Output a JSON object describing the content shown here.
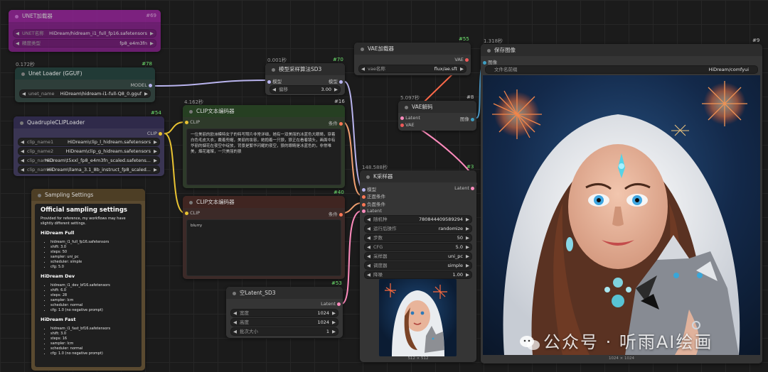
{
  "purple_node": {
    "title": "UNET加载器",
    "id": "#69",
    "field1_label": "UNET名称",
    "field1_value": "HiDream/hidream_i1_full_fp16.safetensors",
    "field2_label": "精度类型",
    "field2_value": "fp8_e4m3fn"
  },
  "unet_loader": {
    "time": "0.172秒",
    "id": "#78",
    "title": "Unet Loader (GGUF)",
    "output": "MODEL",
    "w_label": "unet_name",
    "w_value": "HiDream\\hidream-i1-full-Q8_0.gguf"
  },
  "quad_clip": {
    "id": "#54",
    "title": "QuadrupleCLIPLoader",
    "output": "CLIP",
    "widgets": [
      {
        "label": "clip_name1",
        "value": "HiDream\\clip_l_hidream.safetensors"
      },
      {
        "label": "clip_name2",
        "value": "HiDream\\clip_g_hidream.safetensors"
      },
      {
        "label": "clip_name3",
        "value": "HiDream\\t5xxl_fp8_e4m3fn_scaled.safetens..."
      },
      {
        "label": "clip_name4",
        "value": "HiDream\\llama_3.1_8b_instruct_fp8_scaled..."
      }
    ]
  },
  "model_sampling": {
    "time": "0.001秒",
    "id": "#70",
    "title": "模型采样算法SD3",
    "input": "模型",
    "output": "模型",
    "w_label": "偏移",
    "w_value": "3.00"
  },
  "clip_pos": {
    "time": "4.162秒",
    "id": "#16",
    "title": "CLIP文本编码器",
    "input": "CLIP",
    "output": "条件",
    "text": "一位美丽的欧洲模特女子的特写照片非常详细，她有一双美丽的冰蓝色大眼睛，穿着白色毛皮大衣，戴着兜帽，美丽的妆容，她抱着一只狼，狼正在看着镜头，画面中有华丽的烟花在夜空中绽放，背景是繁华闪耀的夜空，狼的眼睛是冰蓝色的，非常唯美，烟花璀璨，一只美丽的狼"
  },
  "clip_neg": {
    "id": "#40",
    "title": "CLIP文本编码器",
    "input": "CLIP",
    "output": "条件",
    "text": "blurry"
  },
  "sampling_settings": {
    "title": "Sampling Settings",
    "heading": "Official sampling settings",
    "intro": "Provided for reference, my workflows may have slightly different settings.",
    "groups": [
      {
        "name": "HiDream Full",
        "items": [
          "hidream_i1_full_fp16.safetensors",
          "shift: 3.0",
          "steps: 50",
          "sampler: uni_pc",
          "scheduler: simple",
          "cfg: 5.0"
        ]
      },
      {
        "name": "HiDream Dev",
        "items": [
          "hidream_i1_dev_bf16.safetensors",
          "shift: 6.0",
          "steps: 28",
          "sampler: lcm",
          "scheduler: normal",
          "cfg: 1.0 (no negative prompt)"
        ]
      },
      {
        "name": "HiDream Fast",
        "items": [
          "hidream_i1_fast_bf16.safetensors",
          "shift: 3.0",
          "steps: 16",
          "sampler: lcm",
          "scheduler: normal",
          "cfg: 1.0 (no negative prompt)"
        ]
      }
    ]
  },
  "vae_loader": {
    "id": "#55",
    "title": "VAE加载器",
    "output": "VAE",
    "w_label": "vae名称",
    "w_value": "flux/ae.sft"
  },
  "vae_decode": {
    "time": "5.097秒",
    "id": "#8",
    "title": "VAE解码",
    "in1": "Latent",
    "in2": "VAE",
    "output": "图像"
  },
  "ksampler": {
    "time": "148.588秒",
    "id": "#3",
    "title": "K采样器",
    "inputs": [
      "模型",
      "正面条件",
      "负面条件",
      "Latent"
    ],
    "output": "Latent",
    "widgets": [
      {
        "label": "随机种",
        "value": "780844409589294"
      },
      {
        "label": "运行后操作",
        "value": "randomize"
      },
      {
        "label": "步数",
        "value": "50"
      },
      {
        "label": "CFG",
        "value": "5.0"
      },
      {
        "label": "采样器",
        "value": "uni_pc"
      },
      {
        "label": "调度器",
        "value": "simple"
      },
      {
        "label": "降噪",
        "value": "1.00"
      }
    ],
    "preview_size": "512 × 512"
  },
  "empty_latent": {
    "id": "#53",
    "title": "空Latent_SD3",
    "output": "Latent",
    "widgets": [
      {
        "label": "宽度",
        "value": "1024"
      },
      {
        "label": "高度",
        "value": "1024"
      },
      {
        "label": "批次大小",
        "value": "1"
      }
    ]
  },
  "save_image": {
    "time": "1.318秒",
    "id": "#9",
    "title": "保存图像",
    "input": "图像",
    "w_label": "文件名前缀",
    "w_value": "HiDream/comfyui",
    "image_size": "1024 × 1024"
  },
  "watermark": "公众号 · 听雨AI绘画"
}
